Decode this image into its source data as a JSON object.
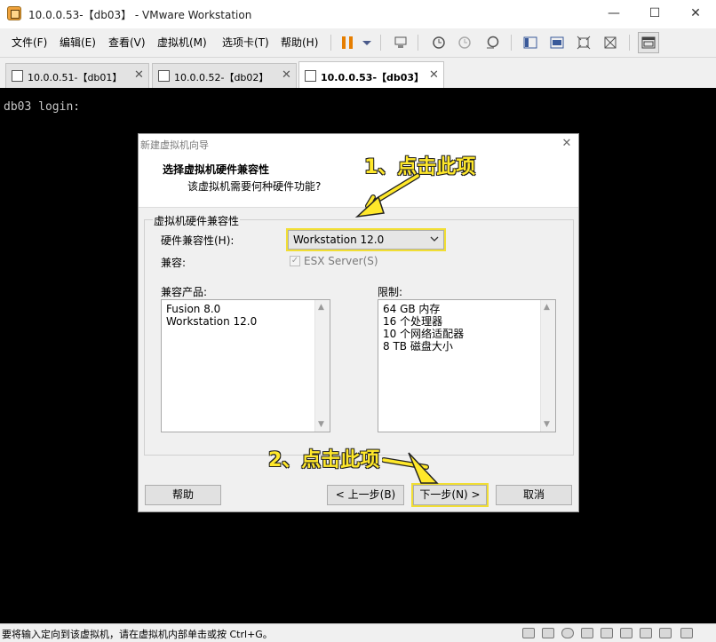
{
  "window": {
    "title": "10.0.0.53-【db03】 - VMware Workstation",
    "minimize": "—",
    "maximize": "☐",
    "close": "✕"
  },
  "menu": {
    "items": [
      "文件(F)",
      "编辑(E)",
      "查看(V)",
      "虚拟机(M)",
      "选项卡(T)",
      "帮助(H)"
    ]
  },
  "toolbar": {
    "icons": [
      "pause-icon",
      "dropdown-icon",
      "send-ctrl-alt-del-icon",
      "snapshot-icon",
      "revert-snapshot-icon",
      "snapshot-manager-icon",
      "library-icon",
      "console-view-icon",
      "fullscreen-icon",
      "unity-icon",
      "thumbnail-view-icon"
    ],
    "accent": "#e67e00"
  },
  "tabs": [
    {
      "label": "10.0.0.51-【db01】",
      "active": false
    },
    {
      "label": "10.0.0.52-【db02】",
      "active": false
    },
    {
      "label": "10.0.0.53-【db03】",
      "active": true
    }
  ],
  "console": {
    "text": "db03 login:"
  },
  "dialog": {
    "title": "新建虚拟机向导",
    "heading": "选择虚拟机硬件兼容性",
    "subheading": "该虚拟机需要何种硬件功能?",
    "group_label": "虚拟机硬件兼容性",
    "hw_label": "硬件兼容性(H):",
    "hw_value": "Workstation 12.0",
    "compat_label": "兼容:",
    "esx_label": "ESX Server(S)",
    "esx_checked": true,
    "products_label": "兼容产品:",
    "products": [
      "Fusion 8.0",
      "Workstation 12.0"
    ],
    "limits_label": "限制:",
    "limits": [
      "64 GB 内存",
      "16 个处理器",
      "10 个网络适配器",
      "8 TB 磁盘大小"
    ],
    "buttons": {
      "help": "帮助",
      "back": "< 上一步(B)",
      "next": "下一步(N) >",
      "cancel": "取消"
    }
  },
  "annotations": {
    "step1": "1、点击此项",
    "step2": "2、点击此项",
    "color": "#ffe82a"
  },
  "status": {
    "text": "要将输入定向到该虚拟机，请在虚拟机内部单击或按 Ctrl+G。"
  },
  "status_icons": [
    "hard-disk-icon",
    "hard-disk-icon",
    "cd-icon",
    "network-icon",
    "usb-icon",
    "sound-icon",
    "printer-icon",
    "display-icon",
    "message-icon"
  ]
}
